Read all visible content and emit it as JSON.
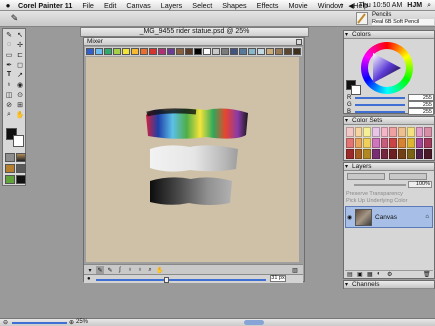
{
  "menubar": {
    "app_name": "Corel Painter 11",
    "items": [
      "File",
      "Edit",
      "Canvas",
      "Layers",
      "Select",
      "Shapes",
      "Effects",
      "Movie",
      "Window",
      "Help"
    ],
    "clock": "Thu 10:50 AM",
    "user": "HJM"
  },
  "property_bar": {
    "brush_category": "Pencils",
    "brush_variant": "Real 6B Soft Pencil"
  },
  "document": {
    "title": "_MG_9455 rider statue.psd @ 25%",
    "zoom": "25%"
  },
  "mixer": {
    "title": "Mixer",
    "swatches": [
      "#2f5fcf",
      "#6dbdf0",
      "#2faa6d",
      "#a6d146",
      "#f2e437",
      "#f7b92f",
      "#ea6e2f",
      "#d7332f",
      "#b33078",
      "#6d3a95",
      "#8d5e3a",
      "#5a3b2a",
      "#000000",
      "#fbfbfb",
      "#c8c8c8",
      "#7c7c7c",
      "#425580",
      "#59799a",
      "#88b7cc",
      "#c3d8e0",
      "#ccad7a",
      "#9a7a55",
      "#5b4630",
      "#3f301e"
    ],
    "zoom_label": "31 px"
  },
  "colors_panel": {
    "title": "Colors",
    "r_label": "R",
    "r_value": "255",
    "g_label": "G",
    "g_value": "255",
    "b_label": "B",
    "b_value": "255"
  },
  "color_sets_panel": {
    "title": "Color Sets"
  },
  "layers_panel": {
    "title": "Layers",
    "opacity": "100%",
    "preserve_transparency": "Preserve Transparency",
    "pick_up_underlying_color": "Pick Up Underlying Color",
    "layer_name": "Canvas"
  },
  "channels_panel": {
    "title": "Channels"
  },
  "status": {
    "zoom": "25%"
  }
}
